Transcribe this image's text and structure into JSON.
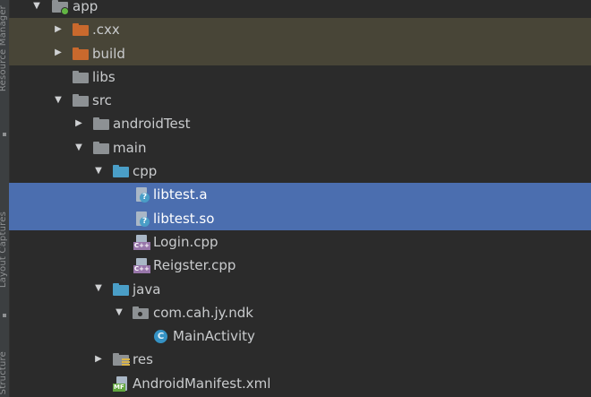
{
  "side_panel": {
    "top_label": "Resource Manager",
    "bottom_label": "Layout Captures",
    "bottom_label2": "Structure"
  },
  "tree": [
    {
      "label": "app",
      "icon": "module-folder-icon",
      "arrow": "expanded",
      "style": "normal"
    },
    {
      "label": ".cxx",
      "icon": "excluded-folder-icon",
      "arrow": "collapsed",
      "style": "excluded"
    },
    {
      "label": "build",
      "icon": "excluded-folder-icon",
      "arrow": "collapsed",
      "style": "excluded"
    },
    {
      "label": "libs",
      "icon": "folder-icon",
      "arrow": "none",
      "style": "normal"
    },
    {
      "label": "src",
      "icon": "folder-icon",
      "arrow": "expanded",
      "style": "normal"
    },
    {
      "label": "androidTest",
      "icon": "folder-icon",
      "arrow": "collapsed",
      "style": "normal"
    },
    {
      "label": "main",
      "icon": "folder-icon",
      "arrow": "expanded",
      "style": "normal"
    },
    {
      "label": "cpp",
      "icon": "source-folder-icon",
      "arrow": "expanded",
      "style": "normal"
    },
    {
      "label": "libtest.a",
      "icon": "unknown-file-icon",
      "arrow": "none",
      "style": "selected"
    },
    {
      "label": "libtest.so",
      "icon": "unknown-file-icon",
      "arrow": "none",
      "style": "selected"
    },
    {
      "label": "Login.cpp",
      "icon": "cpp-file-icon",
      "arrow": "none",
      "style": "normal"
    },
    {
      "label": "Reigster.cpp",
      "icon": "cpp-file-icon",
      "arrow": "none",
      "style": "normal"
    },
    {
      "label": "java",
      "icon": "source-folder-icon",
      "arrow": "expanded",
      "style": "normal"
    },
    {
      "label": "com.cah.jy.ndk",
      "icon": "package-icon",
      "arrow": "expanded",
      "style": "normal"
    },
    {
      "label": "MainActivity",
      "icon": "java-class-icon",
      "arrow": "none",
      "style": "normal"
    },
    {
      "label": "res",
      "icon": "resource-folder-icon",
      "arrow": "collapsed",
      "style": "normal"
    },
    {
      "label": "AndroidManifest.xml",
      "icon": "manifest-file-icon",
      "arrow": "none",
      "style": "normal"
    }
  ],
  "icon_text": {
    "unknown": "?",
    "cpp": "C++",
    "class": "C",
    "manifest": "MF"
  },
  "colors": {
    "background": "#2b2b2b",
    "selection": "#4b6eaf",
    "excluded_row": "#484537",
    "excluded_folder": "#c9692d",
    "source_folder": "#4a9ec7",
    "plain_folder": "#8d9194"
  }
}
